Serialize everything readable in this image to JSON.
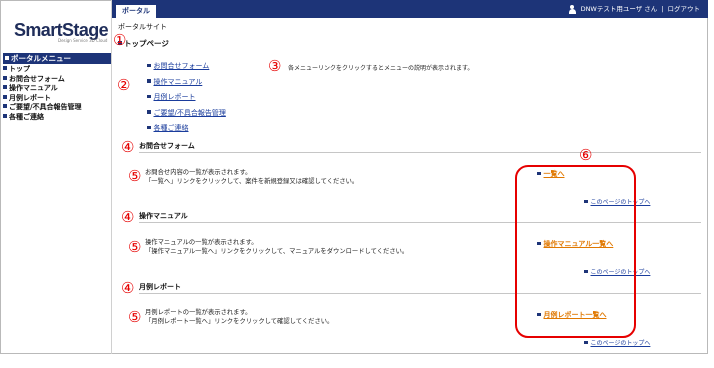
{
  "logo": {
    "brand": "SmartStage",
    "tagline": "Design Service 3D Cloud"
  },
  "sidebar": {
    "heading": "ポータルメニュー",
    "items": [
      {
        "label": "トップ"
      },
      {
        "label": "お問合せフォーム"
      },
      {
        "label": "操作マニュアル"
      },
      {
        "label": "月例レポート"
      },
      {
        "label": "ご要望/不具合報告管理"
      },
      {
        "label": "各種ご連絡"
      }
    ]
  },
  "topbar": {
    "tab_label": "ポータル",
    "user_text": "DNWテスト用ユーザ さん",
    "separator": "|",
    "logout_label": "ログアウト"
  },
  "breadcrumb": "ポータルサイト",
  "topic_heading": "トップページ",
  "links": [
    {
      "label": "お問合せフォーム"
    },
    {
      "label": "操作マニュアル"
    },
    {
      "label": "月例レポート"
    },
    {
      "label": "ご要望/不具合報告管理"
    },
    {
      "label": "各種ご連絡"
    }
  ],
  "hint_text": "各メニューリンクをクリックするとメニューの説明が表示されます。",
  "sections": [
    {
      "title": "お問合せフォーム",
      "desc1": "お問合せ内容の一覧が表示されます。",
      "desc2": "「一覧へ」リンクをクリックして、案件を新規登録又は確認してください。",
      "link_label": "一覧へ",
      "top_label": "このページのトップへ"
    },
    {
      "title": "操作マニュアル",
      "desc1": "操作マニュアルの一覧が表示されます。",
      "desc2": "「操作マニュアル一覧へ」リンクをクリックして、マニュアルをダウンロードしてください。",
      "link_label": "操作マニュアル一覧へ",
      "top_label": "このページのトップへ"
    },
    {
      "title": "月例レポート",
      "desc1": "月例レポートの一覧が表示されます。",
      "desc2": "「月例レポート一覧へ」リンクをクリックして確認してください。",
      "link_label": "月例レポート一覧へ",
      "top_label": "このページのトップへ"
    }
  ],
  "markers": {
    "m1": "①",
    "m2": "②",
    "m3": "③",
    "m4": "④",
    "m5": "⑤",
    "m6": "⑥"
  },
  "colors": {
    "navy": "#1d3478",
    "link_blue": "#1a3c9c",
    "link_orange": "#e07800",
    "annotation_red": "#e60000"
  }
}
